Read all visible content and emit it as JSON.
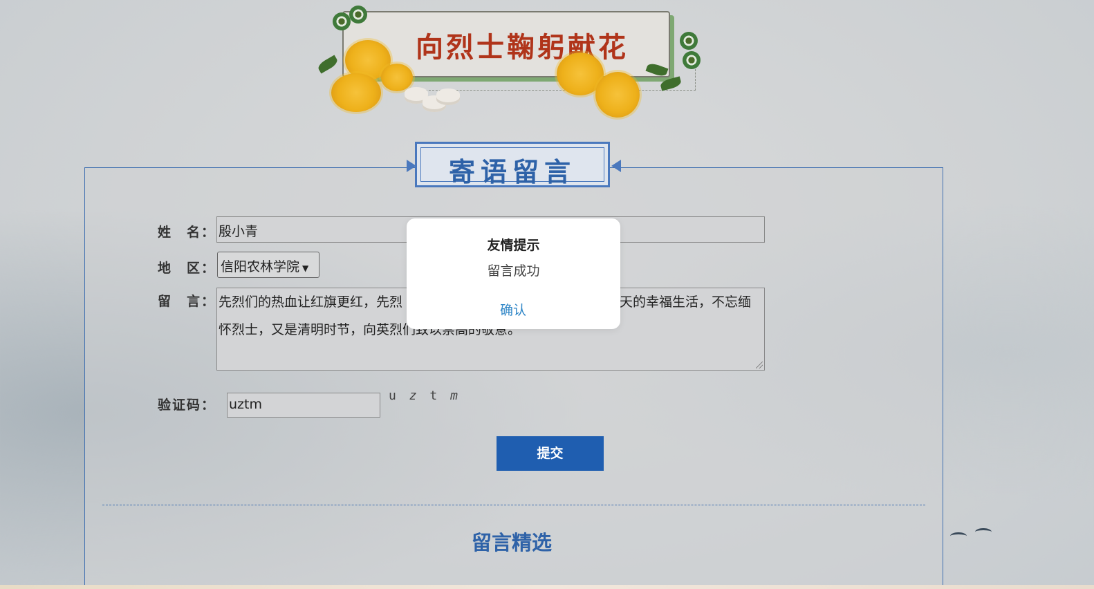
{
  "banner": {
    "title": "向烈士鞠躬献花"
  },
  "section": {
    "title": "寄语留言"
  },
  "form": {
    "name_label": "姓　名：",
    "name_value": "殷小青",
    "region_label": "地　区：",
    "region_value": "信阳农林学院",
    "message_label": "留　言：",
    "message_line1": "先烈们的热血让红旗更红，先烈",
    "message_line1_tail": "天的幸福生活，不忘缅",
    "message_line2": "怀烈士，又是清明时节，向英烈们致以崇高的敬意。",
    "captcha_label": "验证码：",
    "captcha_value": "uztm",
    "captcha_chars": [
      "u",
      "z",
      "t",
      "m"
    ],
    "submit_label": "提交"
  },
  "selected": {
    "title": "留言精选"
  },
  "modal": {
    "title": "友情提示",
    "message": "留言成功",
    "confirm_label": "确认"
  },
  "colors": {
    "accent": "#1f5eb0",
    "title_red": "#b0341a",
    "link_blue": "#2f86c7"
  }
}
